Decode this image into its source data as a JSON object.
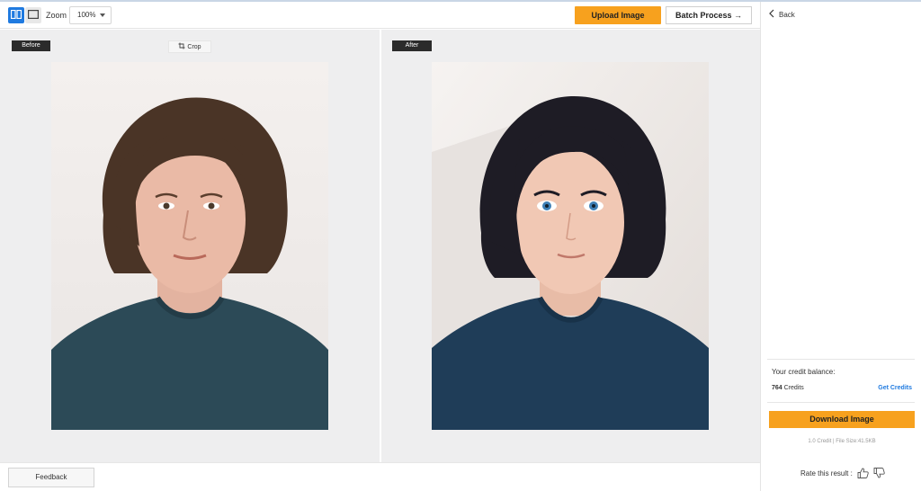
{
  "toolbar": {
    "zoom_label": "Zoom",
    "zoom_value": "100%",
    "upload_label": "Upload Image",
    "batch_label": "Batch Process →"
  },
  "workspace": {
    "before_tag": "Before",
    "after_tag": "After",
    "crop_label": "Crop"
  },
  "bottom": {
    "feedback_label": "Feedback"
  },
  "panel": {
    "back_label": "Back",
    "credit_label": "Your credit balance:",
    "credit_count": "764",
    "credit_unit": " Credits",
    "get_credits_label": "Get Credits",
    "download_label": "Download Image",
    "file_info": "1.0 Credit | File Size:41.5KB",
    "rate_label": "Rate this result :"
  },
  "icons": {
    "split_view": "split-view-icon",
    "single_view": "single-view-icon",
    "crop": "crop-icon",
    "back": "chevron-left-icon",
    "thumbs_up": "thumbs-up-icon",
    "thumbs_down": "thumbs-down-icon"
  },
  "colors": {
    "accent_orange": "#f7a11e",
    "accent_blue": "#1f7ae0",
    "workspace_bg": "#eeeeef",
    "tag_bg": "#2b2b2b"
  }
}
